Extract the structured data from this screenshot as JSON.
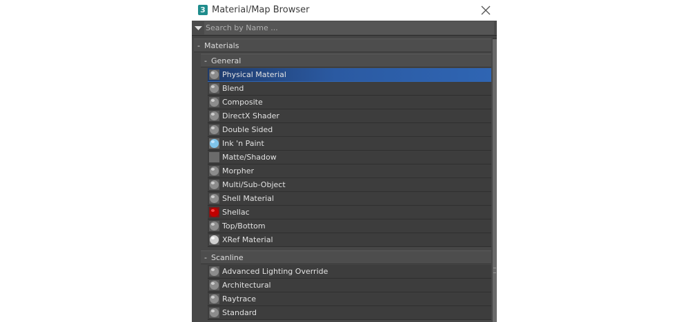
{
  "window": {
    "title": "Material/Map Browser",
    "icon": "3ds-max-app-icon",
    "app_glyph": "3",
    "close_icon": "close-icon"
  },
  "search": {
    "placeholder": "Search by Name ...",
    "value": "",
    "dropdown_icon": "triangle-down-icon"
  },
  "tree": {
    "root": {
      "sign": "-",
      "label": "Materials"
    },
    "groups": [
      {
        "sign": "-",
        "label": "General",
        "items": [
          {
            "label": "Physical Material",
            "icon": "sphere-gray-icon",
            "selected": true
          },
          {
            "label": "Blend",
            "icon": "sphere-gray-icon"
          },
          {
            "label": "Composite",
            "icon": "sphere-gray-icon"
          },
          {
            "label": "DirectX Shader",
            "icon": "sphere-gray-icon"
          },
          {
            "label": "Double Sided",
            "icon": "sphere-gray-icon"
          },
          {
            "label": "Ink 'n Paint",
            "icon": "sphere-lightblue-icon"
          },
          {
            "label": "Matte/Shadow",
            "icon": "flat-gray-square-icon"
          },
          {
            "label": "Morpher",
            "icon": "sphere-gray-icon"
          },
          {
            "label": "Multi/Sub-Object",
            "icon": "sphere-gray-icon"
          },
          {
            "label": "Shell Material",
            "icon": "sphere-gray-icon"
          },
          {
            "label": "Shellac",
            "icon": "sphere-red-icon"
          },
          {
            "label": "Top/Bottom",
            "icon": "sphere-gray-icon"
          },
          {
            "label": "XRef Material",
            "icon": "sphere-white-icon"
          }
        ]
      },
      {
        "sign": "-",
        "label": "Scanline",
        "items": [
          {
            "label": "Advanced Lighting Override",
            "icon": "sphere-gray-icon"
          },
          {
            "label": "Architectural",
            "icon": "sphere-gray-icon"
          },
          {
            "label": "Raytrace",
            "icon": "sphere-gray-icon"
          },
          {
            "label": "Standard",
            "icon": "sphere-gray-icon"
          }
        ]
      }
    ]
  },
  "colors": {
    "panel_bg": "#444444",
    "selection": "#2f65b3",
    "text": "#e2e2e2"
  }
}
